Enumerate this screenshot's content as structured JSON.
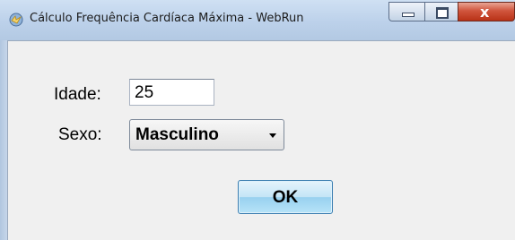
{
  "window": {
    "title": "Cálculo Frequência Cardíaca Máxima - WebRun",
    "icon": "app-icon",
    "controls": {
      "minimize_icon": "minimize-icon",
      "maximize_icon": "maximize-icon",
      "close_glyph": "x"
    }
  },
  "form": {
    "age": {
      "label": "Idade:",
      "value": "25"
    },
    "sex": {
      "label": "Sexo:",
      "selected": "Masculino",
      "icon": "chevron-down-icon"
    },
    "ok_label": "OK"
  },
  "colors": {
    "titlebar": "#bcd1ea",
    "close_button": "#d0553d",
    "client_background": "#f0f0f0",
    "ok_button": "#c4e5f6"
  }
}
